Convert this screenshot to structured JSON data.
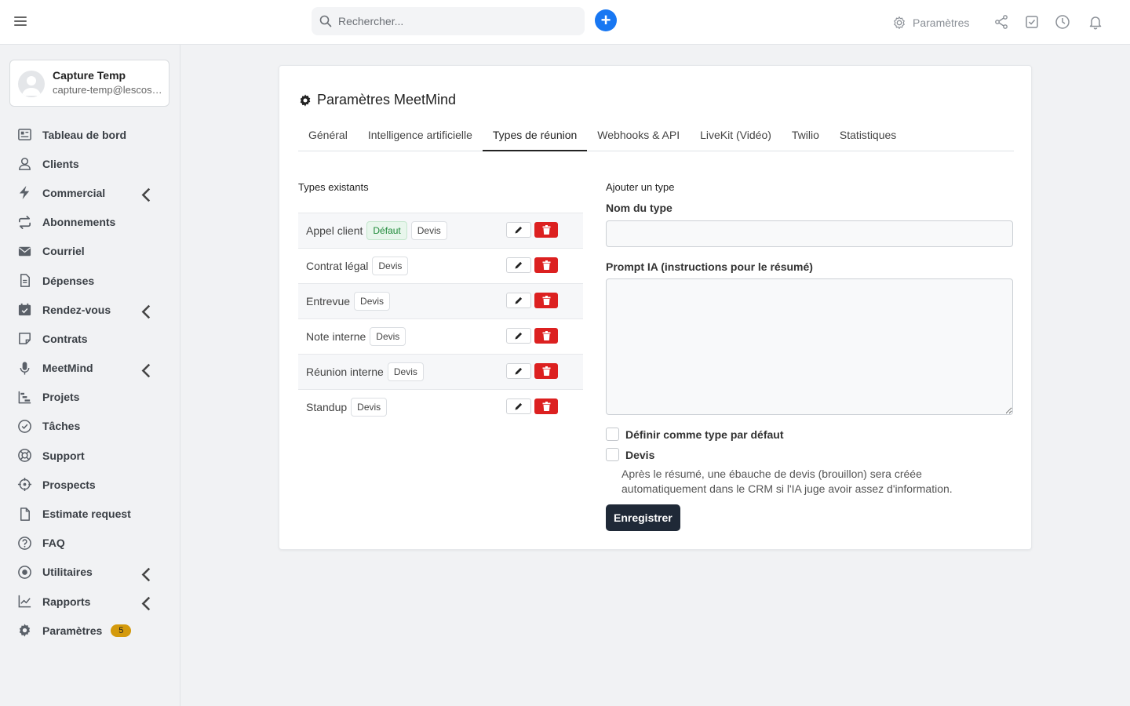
{
  "topbar": {
    "search_placeholder": "Rechercher...",
    "add_label": "+",
    "settings_label": "Paramètres"
  },
  "user": {
    "name": "Capture Temp",
    "email": "capture-temp@lescosys.com"
  },
  "sidebar": {
    "items": [
      {
        "label": "Tableau de bord",
        "icon": "dashboard-icon"
      },
      {
        "label": "Clients",
        "icon": "user-icon"
      },
      {
        "label": "Commercial",
        "icon": "bolt-icon"
      },
      {
        "label": "Abonnements",
        "icon": "repeat-icon"
      },
      {
        "label": "Courriel",
        "icon": "envelope-icon"
      },
      {
        "label": "Dépenses",
        "icon": "file-text-icon"
      },
      {
        "label": "Rendez-vous",
        "icon": "calendar-check-icon"
      },
      {
        "label": "Contrats",
        "icon": "sticky-note-icon"
      },
      {
        "label": "MeetMind",
        "icon": "microphone-icon"
      },
      {
        "label": "Projets",
        "icon": "bar-chart-steps-icon"
      },
      {
        "label": "Tâches",
        "icon": "check-circle-icon"
      },
      {
        "label": "Support",
        "icon": "lifebuoy-icon"
      },
      {
        "label": "Prospects",
        "icon": "crosshairs-icon"
      },
      {
        "label": "Estimate request",
        "icon": "file-icon"
      },
      {
        "label": "FAQ",
        "icon": "question-circle-icon"
      },
      {
        "label": "Utilitaires",
        "icon": "dot-circle-icon"
      },
      {
        "label": "Rapports",
        "icon": "line-chart-icon"
      },
      {
        "label": "Paramètres",
        "icon": "gear-icon",
        "badge": "5"
      }
    ]
  },
  "page": {
    "title": "Paramètres MeetMind",
    "tabs": [
      "Général",
      "Intelligence artificielle",
      "Types de réunion",
      "Webhooks & API",
      "LiveKit (Vidéo)",
      "Twilio",
      "Statistiques"
    ],
    "active_tab": "Types de réunion"
  },
  "types": {
    "heading": "Types existants",
    "rows": [
      {
        "name": "Appel client",
        "default_label": "Défaut",
        "devis_label": "Devis"
      },
      {
        "name": "Contrat légal",
        "devis_label": "Devis"
      },
      {
        "name": "Entrevue",
        "devis_label": "Devis"
      },
      {
        "name": "Note interne",
        "devis_label": "Devis"
      },
      {
        "name": "Réunion interne",
        "devis_label": "Devis"
      },
      {
        "name": "Standup",
        "devis_label": "Devis"
      }
    ]
  },
  "form": {
    "heading": "Ajouter un type",
    "name_label": "Nom du type",
    "name_value": "",
    "prompt_label": "Prompt IA (instructions pour le résumé)",
    "prompt_value": "",
    "default_check_label": "Définir comme type par défaut",
    "devis_check_label": "Devis",
    "help_text": "Après le résumé, une ébauche de devis (brouillon) sera créée automatiquement dans le CRM si l'IA juge avoir assez d'information.",
    "save_label": "Enregistrer"
  },
  "colors": {
    "accent": "#1877f2",
    "danger": "#dc2020",
    "badge": "#d49a0c",
    "dark_button": "#1f2937"
  }
}
